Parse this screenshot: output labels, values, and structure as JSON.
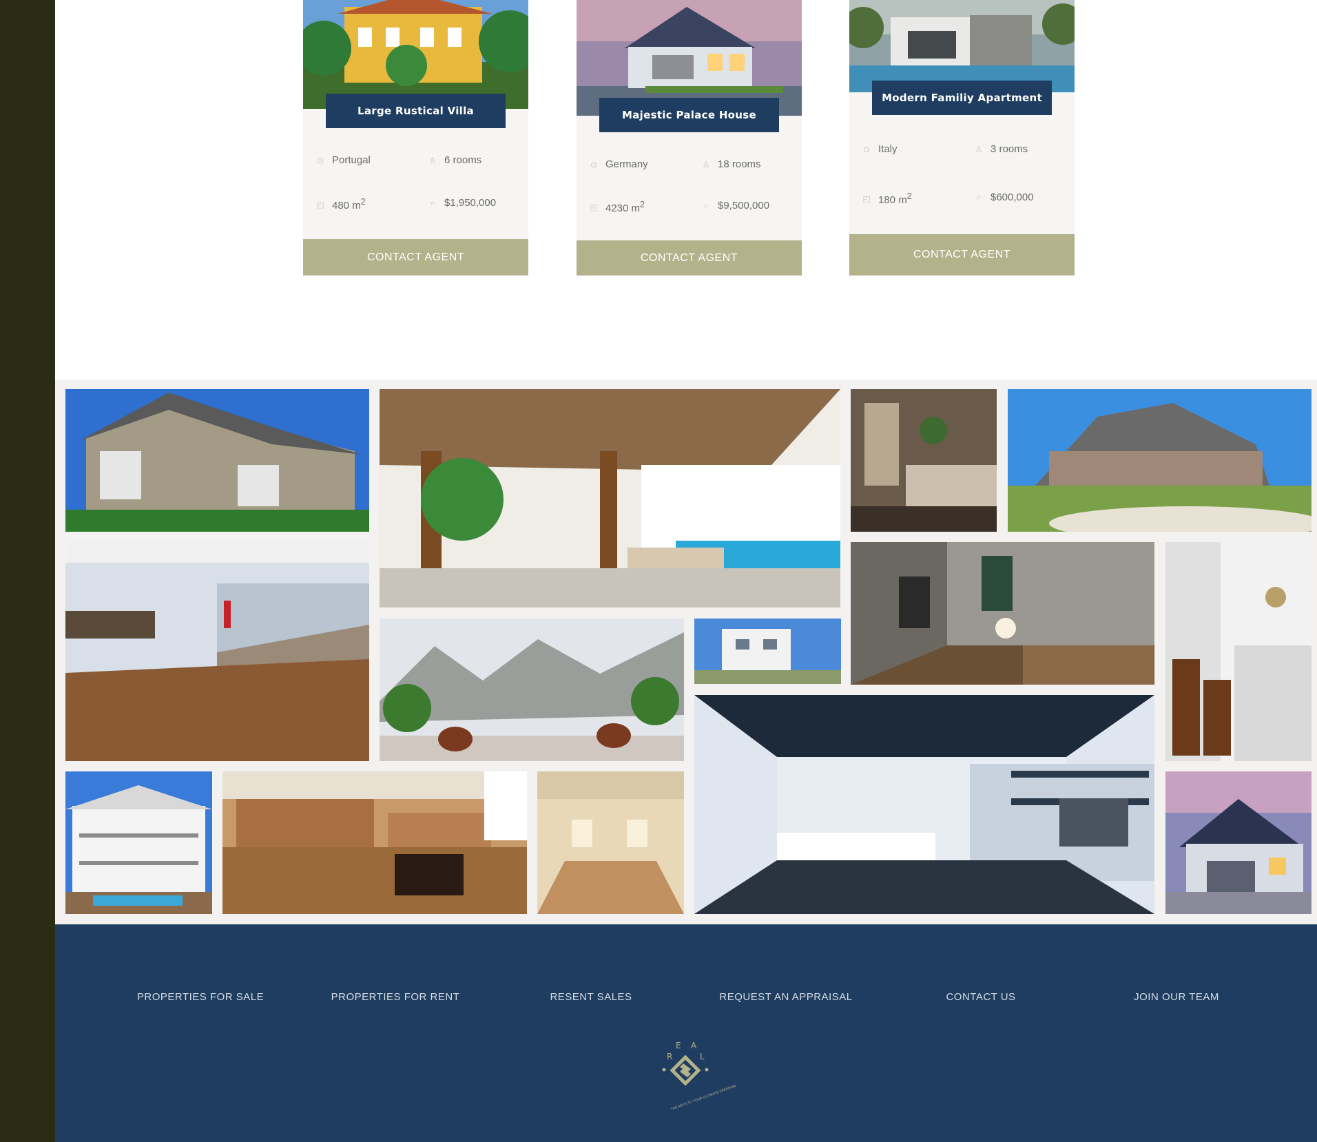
{
  "properties": [
    {
      "title": "Large Rustical Villa",
      "location": "Portugal",
      "rooms": "6 rooms",
      "area": "480 m",
      "area_unit_sup": "2",
      "price": "$1,950,000",
      "button": "CONTACT AGENT"
    },
    {
      "title": "Majestic Palace House",
      "location": "Germany",
      "rooms": "18 rooms",
      "area": "4230 m",
      "area_unit_sup": "2",
      "price": "$9,500,000",
      "button": "CONTACT AGENT"
    },
    {
      "title": "Modern Familiy Apartment",
      "location": "Italy",
      "rooms": "3 rooms",
      "area": "180 m",
      "area_unit_sup": "2",
      "price": "$600,000",
      "button": "CONTACT AGENT"
    }
  ],
  "icons": {
    "location": "map-pin-icon",
    "rooms": "person-icon",
    "area": "area-icon",
    "price": "price-tag-icon"
  },
  "footer": {
    "links": [
      "PROPERTIES FOR SALE",
      "PROPERTIES FOR RENT",
      "RESENT SALES",
      "REQUEST AN APPRAISAL",
      "CONTACT US",
      "JOIN OUR TEAM"
    ],
    "logo": {
      "letters": [
        "R",
        "E",
        "A",
        "L"
      ],
      "tagline": "THE KEYS TO YOUR ULTIMATE FREEDOM"
    }
  },
  "colors": {
    "navy": "#1e3d60",
    "olive": "#b3b28a",
    "sidebar": "#2a2d14",
    "card_bg": "#f6f5f3"
  }
}
